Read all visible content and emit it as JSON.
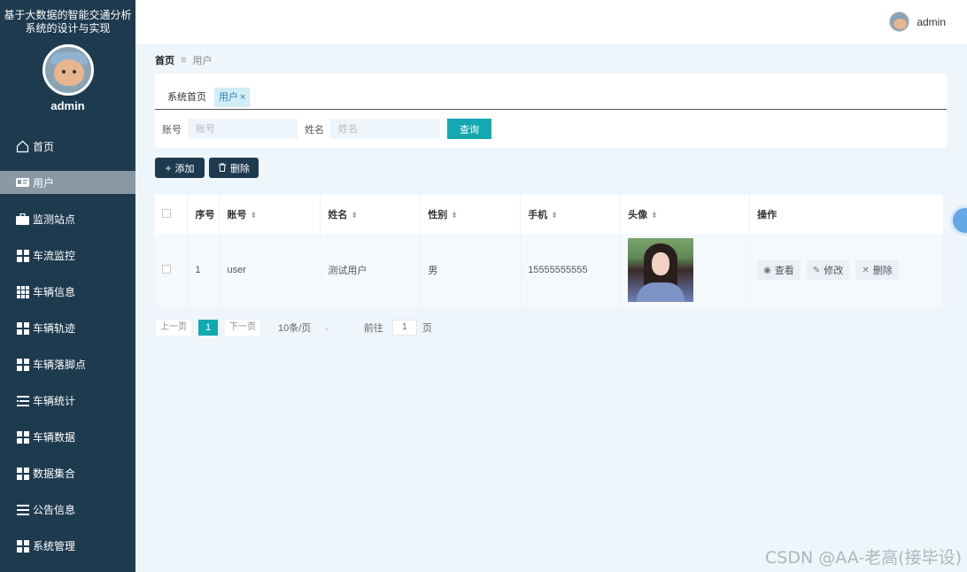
{
  "sidebar": {
    "title": "基于大数据的智能交通分析系统的设计与实现",
    "username": "admin",
    "menu": [
      {
        "label": "首页",
        "icon": "home-icon"
      },
      {
        "label": "用户",
        "icon": "id-card-icon"
      },
      {
        "label": "监测站点",
        "icon": "briefcase-icon"
      },
      {
        "label": "车流监控",
        "icon": "grid-icon"
      },
      {
        "label": "车辆信息",
        "icon": "grid-9-icon"
      },
      {
        "label": "车辆轨迹",
        "icon": "grid-icon"
      },
      {
        "label": "车辆落脚点",
        "icon": "grid-icon"
      },
      {
        "label": "车辆统计",
        "icon": "list-icon"
      },
      {
        "label": "车辆数据",
        "icon": "grid-icon"
      },
      {
        "label": "数据集合",
        "icon": "grid-icon"
      },
      {
        "label": "公告信息",
        "icon": "menu-icon"
      },
      {
        "label": "系统管理",
        "icon": "grid-icon"
      }
    ],
    "active_index": 1
  },
  "topbar": {
    "username": "admin"
  },
  "breadcrumb": {
    "home": "首页",
    "current": "用户"
  },
  "tabs": [
    {
      "label": "系统首页"
    },
    {
      "label": "用户",
      "close": "×"
    }
  ],
  "search": {
    "account_label": "账号",
    "account_placeholder": "账号",
    "name_label": "姓名",
    "name_placeholder": "姓名",
    "query_button": "查询"
  },
  "actions": {
    "add": "添加",
    "delete": "删除"
  },
  "table": {
    "headers": [
      "序号",
      "账号",
      "姓名",
      "性别",
      "手机",
      "头像",
      "操作"
    ],
    "rows": [
      {
        "index": "1",
        "account": "user",
        "name": "测试用户",
        "gender": "男",
        "phone": "15555555555"
      }
    ],
    "ops": {
      "view": "查看",
      "edit": "修改",
      "delete": "删除"
    }
  },
  "pagination": {
    "prev": "上一页",
    "current": "1",
    "next": "下一页",
    "page_size": "10条/页",
    "goto_label": "前往",
    "goto_value": "1",
    "page_suffix": "页"
  },
  "watermark": "CSDN @AA-老高(接毕设)",
  "colors": {
    "sidebar_bg": "#1e3a4f",
    "accent": "#14a9b0",
    "page_bg": "#eef5fb"
  }
}
